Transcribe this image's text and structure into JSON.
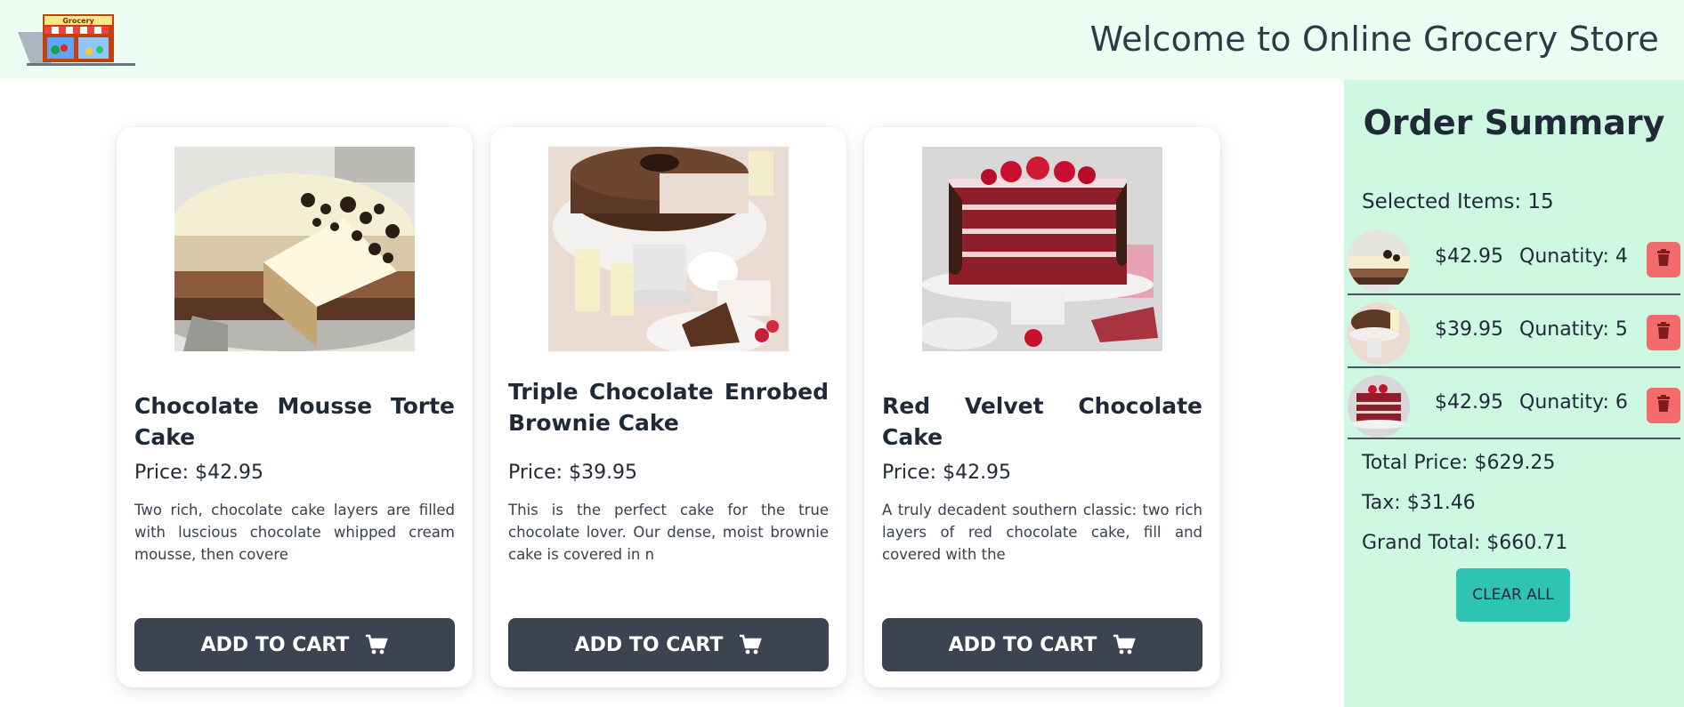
{
  "header": {
    "title": "Welcome to Online Grocery Store",
    "logo_text": "Grocery"
  },
  "products": [
    {
      "title": "Chocolate Mousse Torte Cake",
      "price": "Price: $42.95",
      "description": "Two rich, chocolate cake layers are filled with luscious chocolate whipped cream mousse, then covere",
      "button": "ADD TO CART"
    },
    {
      "title": "Triple Chocolate Enrobed Brownie Cake",
      "price": "Price: $39.95",
      "description": "This is the perfect cake for the true chocolate lover. Our dense, moist brownie cake is covered in n",
      "button": "ADD TO CART"
    },
    {
      "title": "Red Velvet Chocolate Cake",
      "price": "Price: $42.95",
      "description": "A truly decadent southern classic: two rich layers of red chocolate cake, fill and covered with the",
      "button": "ADD TO CART"
    }
  ],
  "summary": {
    "title": "Order Summary",
    "selected": "Selected Items: 15",
    "items": [
      {
        "price": "$42.95",
        "qty": "Qunatity: 4"
      },
      {
        "price": "$39.95",
        "qty": "Qunatity: 5"
      },
      {
        "price": "$42.95",
        "qty": "Qunatity: 6"
      }
    ],
    "total": "Total Price: $629.25",
    "tax": "Tax: $31.46",
    "grand_total": "Grand Total: $660.71",
    "clear_button": "CLEAR ALL"
  },
  "colors": {
    "header_bg": "#ecfdf3",
    "summary_bg": "#cff8e2",
    "button_dark": "#3d4451",
    "delete_red": "#f46b6b",
    "clear_teal": "#2ec4b3"
  },
  "icons": {
    "cart": "shopping-cart-icon",
    "delete": "trash-icon",
    "logo": "grocery-store-icon"
  }
}
